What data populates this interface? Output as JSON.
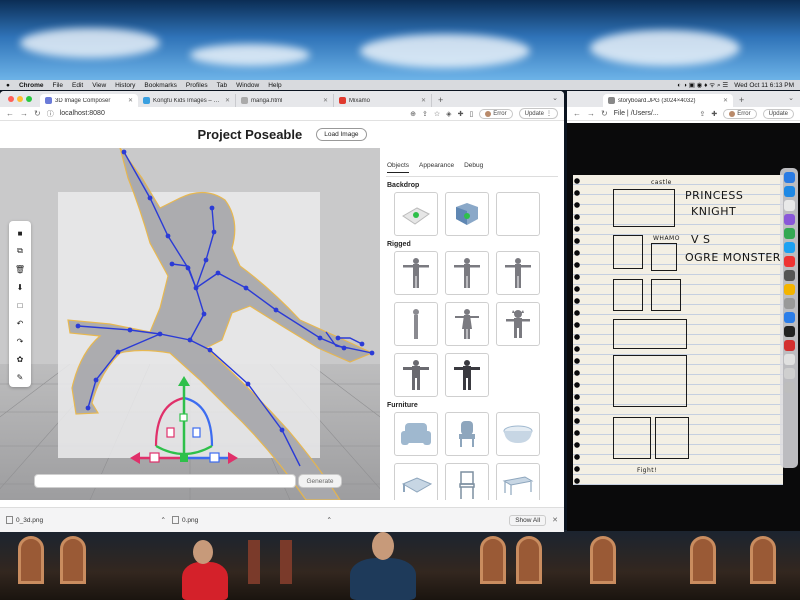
{
  "menubar": {
    "app": "Chrome",
    "items": [
      "File",
      "Edit",
      "View",
      "History",
      "Bookmarks",
      "Profiles",
      "Tab",
      "Window",
      "Help"
    ],
    "clock": "Wed Oct 11  6:13 PM"
  },
  "browser": {
    "tabs": [
      {
        "title": "3D Image Composer",
        "active": true
      },
      {
        "title": "Kongfu Kids Images – Browse",
        "active": false
      },
      {
        "title": "manga.html",
        "active": false
      },
      {
        "title": "Mixamo",
        "active": false
      }
    ],
    "url": "localhost:8080",
    "error_label": "Error",
    "update_label": "Update"
  },
  "app": {
    "title": "Project Poseable",
    "load_button": "Load Image",
    "generate_button": "Generate",
    "toolbar_icons": [
      "camera-icon",
      "duplicate-icon",
      "trash-icon",
      "download-icon",
      "square-icon",
      "undo-icon",
      "redo-icon",
      "settings-icon",
      "brush-icon"
    ]
  },
  "panel": {
    "tabs": [
      "Objects",
      "Appearance",
      "Debug"
    ],
    "sections": {
      "backdrop": "Backdrop",
      "rigged": "Rigged",
      "furniture": "Furniture"
    }
  },
  "downloads": {
    "items": [
      "0_3d.png",
      "0.png"
    ],
    "show_all": "Show All"
  },
  "browser2": {
    "tab_title": "storyboard.JPG (3024×4032)",
    "url": "File  |  /Users/...",
    "error_label": "Error",
    "update_label": "Update"
  },
  "notebook": {
    "line1": "PRINCESS",
    "line2": "KNIGHT",
    "line3": "V S",
    "line4": "OGRE MONSTER",
    "castle": "castle",
    "wham": "WHAMO",
    "fight": "Fight!"
  },
  "colors": {
    "skeleton": "#2b3bd6",
    "gizmo_y": "#2ec04a",
    "gizmo_x": "#e0306a",
    "gizmo_z": "#3c6cf0"
  }
}
